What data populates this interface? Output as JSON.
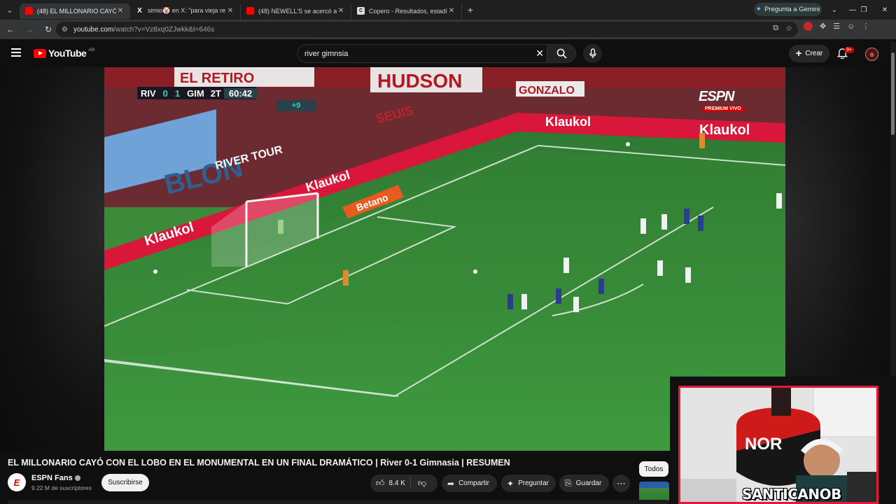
{
  "browser": {
    "tabs": [
      {
        "label": "(48) EL MILLONARIO CAYÓ CON",
        "favicon": "youtube-icon",
        "active": true
      },
      {
        "label": "simio🤡 en X: \"para vieja re ex",
        "favicon": "x-icon",
        "active": false
      },
      {
        "label": "(48) NEWELL'S se acercó a la Pi",
        "favicon": "youtube-icon",
        "active": false
      },
      {
        "label": "Copero - Resultados, estadístic",
        "favicon": "copero-icon",
        "active": false
      }
    ],
    "gemini_label": "Pregunta a Gemini",
    "url_host": "youtube.com",
    "url_path": "/watch?v=Vz8xq0ZJwkk&t=646s"
  },
  "youtube": {
    "logo_text": "YouTube",
    "country_code": "AR",
    "search_value": "river gimnsia",
    "create_label": "Crear",
    "notifications_badge": "9+",
    "accent_color": "#ff0000"
  },
  "video": {
    "scoreboard": {
      "home": "RIV",
      "home_score": "0",
      "away_score": "1",
      "away": "GIM",
      "half": "2T",
      "time": "60:42",
      "added_time": "+9"
    },
    "broadcaster": "ESPN",
    "broadcaster_sub": "PREMIUM VIVO",
    "ad_boards": [
      "Klaukol",
      "Betano"
    ],
    "banners": [
      "HUDSON",
      "GONZALO",
      "EL RETIRO",
      "RIVER TOUR",
      "SEUIS",
      "BLON"
    ]
  },
  "details": {
    "title": "EL MILLONARIO CAYÓ CON EL LOBO EN EL MONUMENTAL EN UN FINAL DRAMÁTICO | River 0-1 Gimnasia | RESUMEN",
    "channel_name": "ESPN Fans",
    "subscribers": "9.22 M de suscriptores",
    "subscribe_label": "Suscribirse",
    "likes": "8.4 K",
    "share_label": "Compartir",
    "ask_label": "Preguntar",
    "save_label": "Guardar",
    "filter_chip": "Todos"
  },
  "overlay": {
    "streamer_name": "SANTICANOB",
    "club_text": "NOR"
  }
}
